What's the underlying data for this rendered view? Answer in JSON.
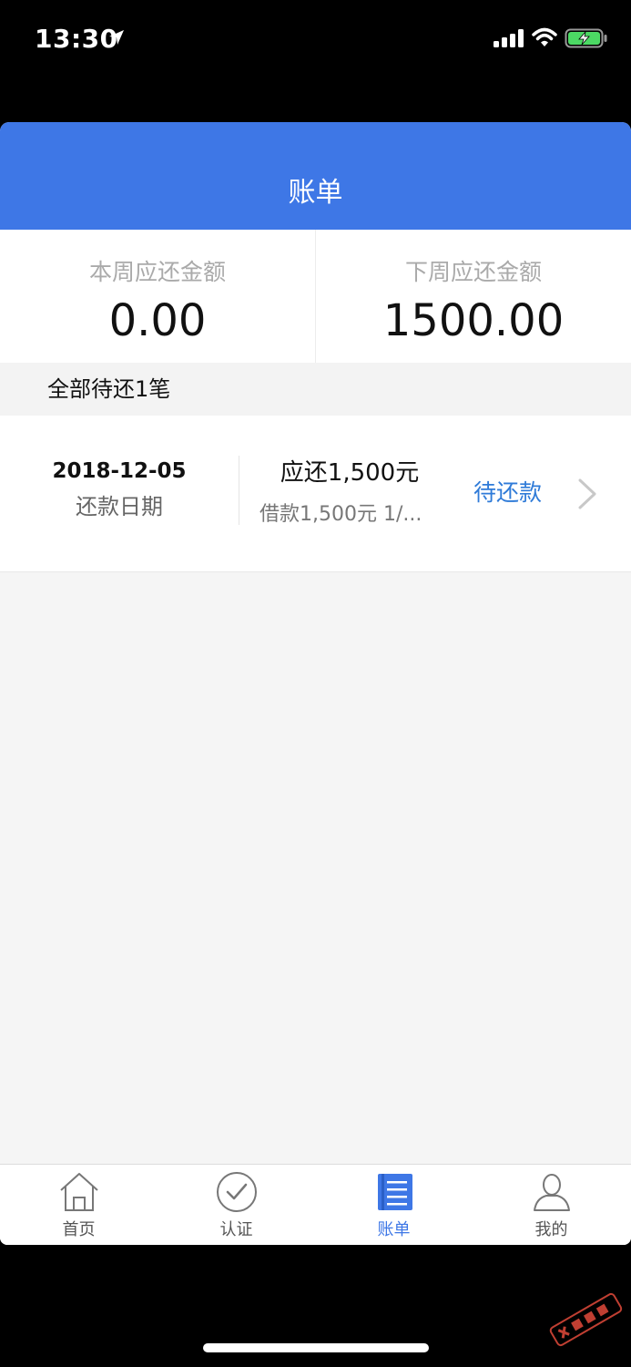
{
  "status_bar": {
    "time": "13:30"
  },
  "nav": {
    "title": "账单"
  },
  "summary": {
    "this_week_label": "本周应还金额",
    "this_week_value": "0.00",
    "next_week_label": "下周应还金额",
    "next_week_value": "1500.00"
  },
  "section": {
    "title": "全部待还1笔"
  },
  "bills": [
    {
      "date": "2018-12-05",
      "date_label": "还款日期",
      "amount": "应还1,500元",
      "detail": "借款1,500元 1/...",
      "status": "待还款"
    }
  ],
  "tabs": [
    {
      "label": "首页",
      "icon": "home-icon"
    },
    {
      "label": "认证",
      "icon": "check-circle-icon"
    },
    {
      "label": "账单",
      "icon": "bill-icon"
    },
    {
      "label": "我的",
      "icon": "user-icon"
    }
  ],
  "active_tab": "账单",
  "colors": {
    "primary": "#3e77e6",
    "status_link": "#2f7bd8",
    "background": "#f5f5f5"
  }
}
